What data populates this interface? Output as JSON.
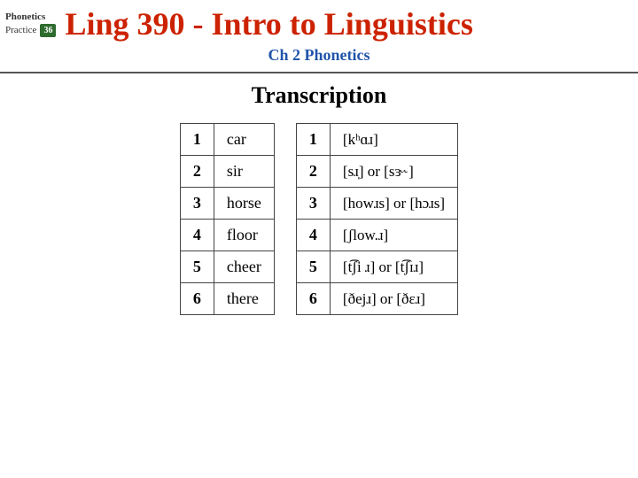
{
  "header": {
    "phonetics_label": "Phonetics",
    "practice_label": "Practice",
    "practice_number": "36",
    "title": "Ling 390 - Intro to Linguistics",
    "subtitle": "Ch 2 Phonetics"
  },
  "section": {
    "title": "Transcription"
  },
  "left_table": {
    "rows": [
      {
        "num": "1",
        "word": "car"
      },
      {
        "num": "2",
        "word": "sir"
      },
      {
        "num": "3",
        "word": "horse"
      },
      {
        "num": "4",
        "word": "floor"
      },
      {
        "num": "5",
        "word": "cheer"
      },
      {
        "num": "6",
        "word": "there"
      }
    ]
  },
  "right_table": {
    "rows": [
      {
        "num": "1",
        "ipa": "[kʰɑɹ]"
      },
      {
        "num": "2",
        "ipa": "[sɹ̩] or [sɝ˞]"
      },
      {
        "num": "3",
        "ipa": "[howɹs] or [hɔɹs]"
      },
      {
        "num": "4",
        "ipa": "[ʃlow.ɹ]"
      },
      {
        "num": "5",
        "ipa": "[t͡ʃi ɹ] or [t͡ʃɪɹ]"
      },
      {
        "num": "6",
        "ipa": "[ðejɹ] or [ðɛɹ]"
      }
    ]
  }
}
